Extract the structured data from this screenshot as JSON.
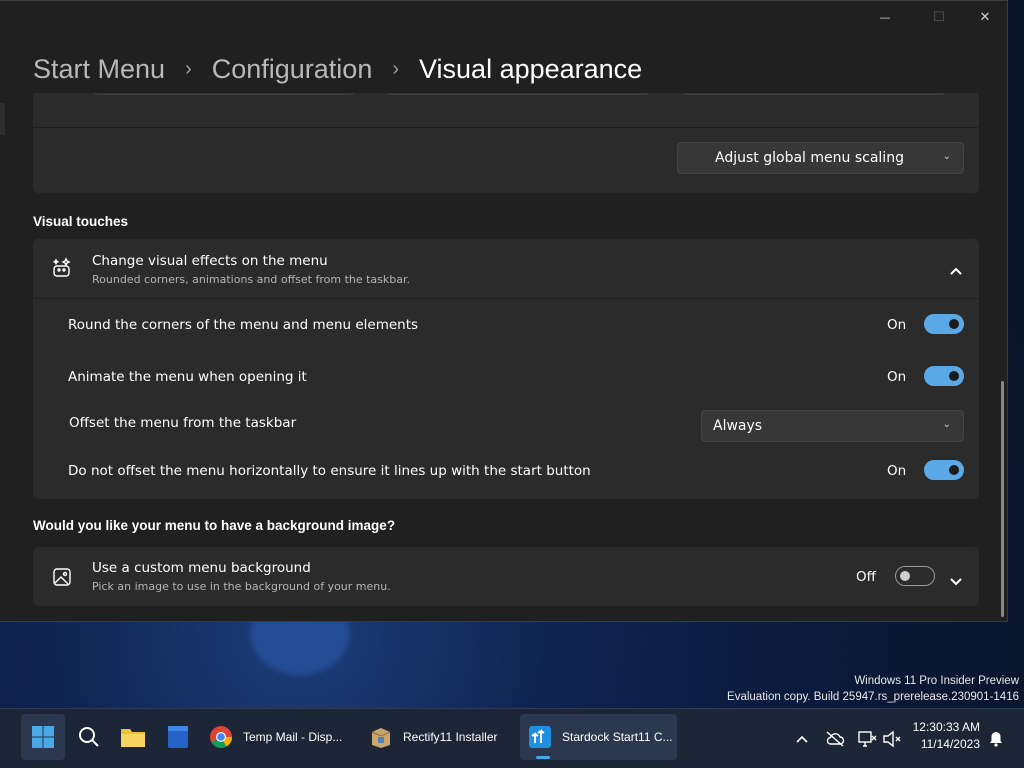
{
  "window": {
    "breadcrumb": [
      "Start Menu",
      "Configuration",
      "Visual appearance"
    ],
    "controls": {
      "minimize": "—",
      "maximize": "☐",
      "close": "✕"
    }
  },
  "scaling": {
    "dropdown_label": "Adjust global menu scaling"
  },
  "visual_touches": {
    "section_title": "Visual touches",
    "group": {
      "title": "Change visual effects on the menu",
      "subtitle": "Rounded corners, animations and offset from the taskbar."
    },
    "rows": [
      {
        "label": "Round the corners of the menu and menu elements",
        "state": "On"
      },
      {
        "label": "Animate the menu when opening it",
        "state": "On"
      },
      {
        "label": "Offset the menu from the taskbar",
        "value": "Always"
      },
      {
        "label": "Do not offset the menu horizontally to ensure it lines up with the start button",
        "state": "On"
      }
    ]
  },
  "background_image": {
    "section_title": "Would you like your menu to have a background image?",
    "title": "Use a custom menu background",
    "subtitle": "Pick an image to use in the background of your menu.",
    "state": "Off"
  },
  "watermark": {
    "line1": "Windows 11 Pro Insider Preview",
    "line2": "Evaluation copy. Build 25947.rs_prerelease.230901-1416"
  },
  "taskbar": {
    "apps": [
      {
        "label": "Temp Mail - Disp..."
      },
      {
        "label": "Rectify11 Installer"
      },
      {
        "label": "Stardock Start11 C..."
      }
    ],
    "clock": {
      "time": "12:30:33 AM",
      "date": "11/14/2023"
    }
  },
  "colors": {
    "accent": "#5aa9e6",
    "window_bg": "#202020",
    "card_bg": "#2b2b2b"
  }
}
